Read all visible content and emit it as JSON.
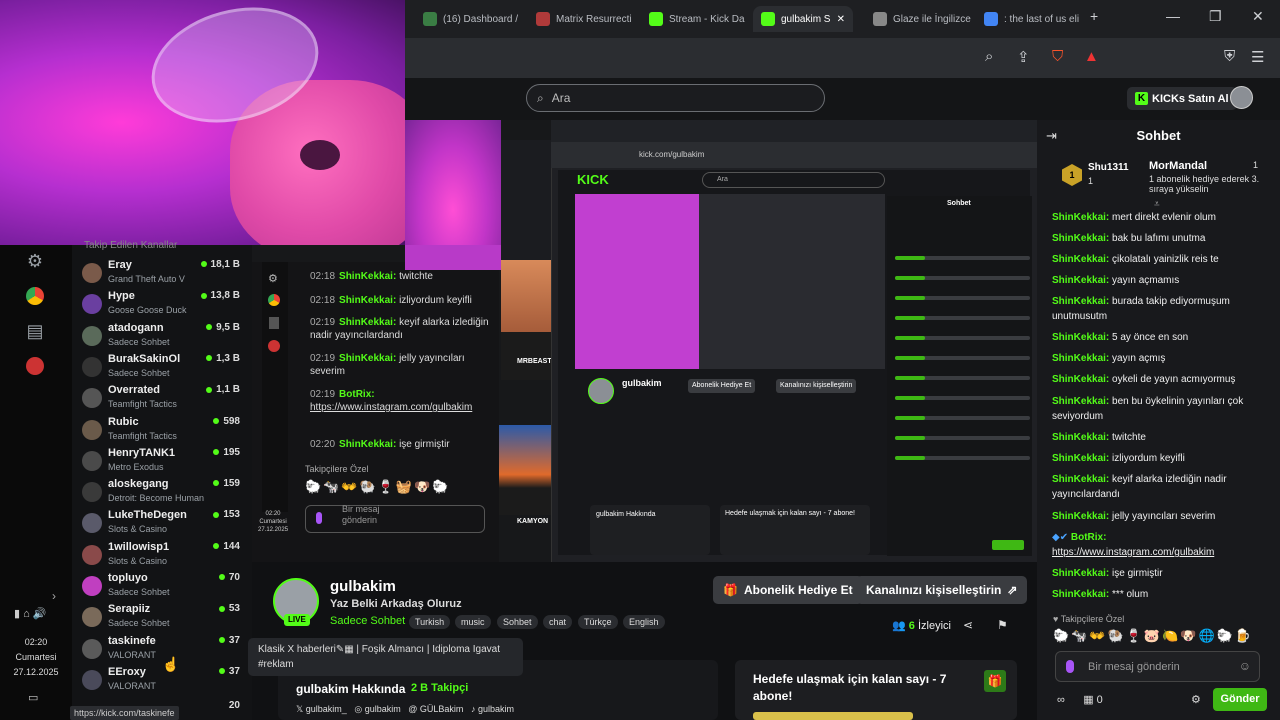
{
  "browser": {
    "tabs": [
      {
        "label": "(16) Dashboard /",
        "color": "#3a7d44"
      },
      {
        "label": "Matrix Resurrecti",
        "color": "#b03a3a"
      },
      {
        "label": "Stream - Kick Da",
        "color": "#53fc18"
      },
      {
        "label": "gulbakim S",
        "color": "#53fc18"
      },
      {
        "label": "Glaze ile İngilizce",
        "color": "#888888"
      },
      {
        "label": ": the last of us eli",
        "color": "#4285f4"
      }
    ],
    "new_tab": "+",
    "minimize": "—",
    "maximize": "❐",
    "close": "✕"
  },
  "kick": {
    "search_placeholder": "Ara",
    "kicks_button": "KICKs Satın Al"
  },
  "dock": {
    "time": "02:20",
    "day": "Cumartesi",
    "date": "27.12.2025"
  },
  "channels": {
    "header": "Takip Edilen Kanallar",
    "items": [
      {
        "name": "Eray",
        "game": "Grand Theft Auto V",
        "viewers": "18,1 B",
        "color": "#7a5a4a"
      },
      {
        "name": "Hype",
        "game": "Goose Goose Duck",
        "viewers": "13,8 B",
        "color": "#6a3fa0"
      },
      {
        "name": "atadogann",
        "game": "Sadece Sohbet",
        "viewers": "9,5 B",
        "color": "#5a6a5a"
      },
      {
        "name": "BurakSakinOl",
        "game": "Sadece Sohbet",
        "viewers": "1,3 B",
        "color": "#333333"
      },
      {
        "name": "Overrated",
        "game": "Teamfight Tactics",
        "viewers": "1,1 B",
        "color": "#555555"
      },
      {
        "name": "Rubic",
        "game": "Teamfight Tactics",
        "viewers": "598",
        "color": "#6a5a4a"
      },
      {
        "name": "HenryTANK1",
        "game": "Metro Exodus",
        "viewers": "195",
        "color": "#4a4a4a"
      },
      {
        "name": "aloskegang",
        "game": "Detroit: Become Human",
        "viewers": "159",
        "color": "#3a3a3a"
      },
      {
        "name": "LukeTheDegen",
        "game": "Slots & Casino",
        "viewers": "153",
        "color": "#5a5a6a"
      },
      {
        "name": "1willowisp1",
        "game": "Slots & Casino",
        "viewers": "144",
        "color": "#8a4a4a"
      },
      {
        "name": "topluyo",
        "game": "Sadece Sohbet",
        "viewers": "70",
        "color": "#c03fc0"
      },
      {
        "name": "Serapiiz",
        "game": "Sadece Sohbet",
        "viewers": "53",
        "color": "#7a6a5a"
      },
      {
        "name": "taskinefe",
        "game": "VALORANT",
        "viewers": "37",
        "color": "#5a5a5a"
      },
      {
        "name": "EEroxy",
        "game": "VALORANT",
        "viewers": "37",
        "color": "#4a4a5a"
      }
    ],
    "last_partial_viewers": "20",
    "status_url": "https://kick.com/taskinefe"
  },
  "nested": {
    "chat": [
      {
        "time": "02:18",
        "user": "ShinKekkai:",
        "text": "twitchte"
      },
      {
        "time": "02:18",
        "user": "ShinKekkai:",
        "text": "izliyordum keyifli"
      },
      {
        "time": "02:19",
        "user": "ShinKekkai:",
        "text": "keyif alarka izlediğin nadir yayıncılardandı"
      },
      {
        "time": "02:19",
        "user": "ShinKekkai:",
        "text": "jelly yayıncıları severim"
      },
      {
        "time": "02:19",
        "user": "BotRix:",
        "text": "https://www.instagram.com/gulbakim"
      },
      {
        "time": "02:20",
        "user": "ShinKekkai:",
        "text": "işe girmiştir"
      }
    ],
    "followers_only": "Takipçilere Özel",
    "input_placeholder": "Bir mesaj gönderin",
    "time": "02:20",
    "day": "Cumartesi",
    "date": "27.12.2025",
    "inner_url": "kick.com/gulbakim",
    "inner_logo": "KICK",
    "inner_search": "Ara",
    "inner_chat_title": "Sohbet",
    "inner_channel": "gulbakim",
    "inner_gift": "Abonelik Hediye Et",
    "inner_custom": "Kanalınızı kişiselleştirin",
    "inner_about": "gulbakim Hakkında",
    "inner_goal": "Hedefe ulaşmak için kalan sayı - 7 abone!",
    "mrbeast": "MRBEAST",
    "kamyon": "KAMYON"
  },
  "channel": {
    "name": "gulbakim",
    "title": "Yaz Belki Arkadaş Oluruz",
    "category": "Sadece Sohbet",
    "live": "LIVE",
    "tags": [
      "Turkish",
      "music",
      "Sohbet",
      "chat",
      "Türkçe",
      "English"
    ],
    "gift_button": "Abonelik Hediye Et",
    "customize_button": "Kanalınızı kişiselleştirin",
    "viewers_count": "6",
    "viewers_label": "İzleyici",
    "tooltip": "Klasik X haberleri✎▦ | Foşik Almancı | Idiploma Igavat #reklam",
    "about_title": "gulbakim Hakkında",
    "followers": "2 B Takipçi",
    "socials": [
      "gulbakim_",
      "gulbakim",
      "GÜLBakim",
      "gulbakim"
    ],
    "goal": "Hedefe ulaşmak için kalan sayı - 7 abone!"
  },
  "chat": {
    "title": "Sohbet",
    "pinned": {
      "top_user": "Shu1311",
      "top_count": "1",
      "gift_user": "MorMandal",
      "gift_count": "1",
      "gift_desc": "1 abonelik hediye ederek 3. sıraya yükselin"
    },
    "messages": [
      {
        "user": "ShinKekkai:",
        "text": "mert direkt evlenir olum"
      },
      {
        "user": "ShinKekkai:",
        "text": "bak bu lafımı unutma"
      },
      {
        "user": "ShinKekkai:",
        "text": "çikolatalı yainizlik reis te"
      },
      {
        "user": "ShinKekkai:",
        "text": "yayın açmamıs"
      },
      {
        "user": "ShinKekkai:",
        "text": "burada takip ediyormuşum unutmusutm"
      },
      {
        "user": "ShinKekkai:",
        "text": "5 ay önce en son"
      },
      {
        "user": "ShinKekkai:",
        "text": "yayın açmış"
      },
      {
        "user": "ShinKekkai:",
        "text": "oykeli de yayın acmıyormuş"
      },
      {
        "user": "ShinKekkai:",
        "text": "ben bu öykelinin yayınları çok seviyordum"
      },
      {
        "user": "ShinKekkai:",
        "text": "twitchte"
      },
      {
        "user": "ShinKekkai:",
        "text": "izliyordum keyifli"
      },
      {
        "user": "ShinKekkai:",
        "text": "keyif alarka izlediğin nadir yayıncılardandı"
      },
      {
        "user": "ShinKekkai:",
        "text": "jelly yayıncıları severim"
      },
      {
        "user": "BotRix:",
        "text": "https://www.instagram.com/gulbakim"
      },
      {
        "user": "ShinKekkai:",
        "text": "işe girmiştir"
      },
      {
        "user": "ShinKekkai:",
        "text": "*** olum"
      }
    ],
    "followers_only": "Takipçilere Özel",
    "input_placeholder": "Bir mesaj gönderin",
    "footer_count": "0",
    "send": "Gönder"
  }
}
